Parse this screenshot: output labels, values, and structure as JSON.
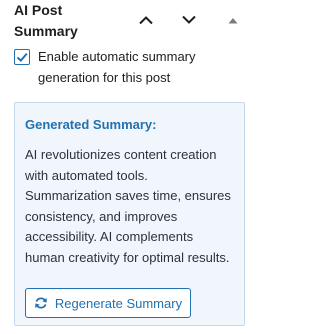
{
  "panel": {
    "title": "AI Post Summary",
    "move_up_icon": "chevron-up-icon",
    "move_down_icon": "chevron-down-icon",
    "toggle_icon": "caret-up-icon"
  },
  "settings": {
    "enable_checkbox": {
      "checked": true,
      "label": "Enable automatic summary generation for this post"
    }
  },
  "summary": {
    "heading": "Generated Summary:",
    "text": "AI revolutionizes content creation with automated tools. Summarization saves time, ensures consistency, and improves accessibility. AI complements human creativity for optimal results.",
    "regenerate_label": "Regenerate Summary",
    "regenerate_icon": "refresh-icon"
  },
  "colors": {
    "accent": "#2271b1",
    "box_background": "#f0f6fc",
    "box_border": "#c5d9ed",
    "text": "#1e1e1e"
  }
}
